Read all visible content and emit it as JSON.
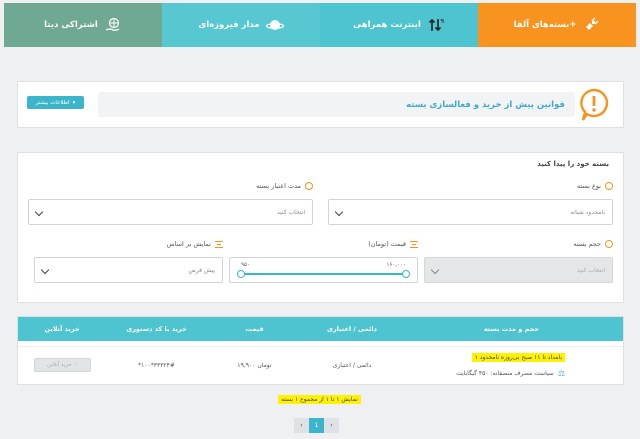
{
  "tabs": [
    {
      "label": "بسته‌های آلفا+",
      "icon": "satellite-icon",
      "color": "#f7931e"
    },
    {
      "label": "اینترنت همراهی",
      "icon": "data-arrows-icon",
      "color": "#4dc4d0"
    },
    {
      "label": "مدار فیروزه‌ای",
      "icon": "planet-icon",
      "color": "#57c7d2"
    },
    {
      "label": "اشتراکی دیتا",
      "icon": "globe-hand-icon",
      "color": "#6fa993"
    }
  ],
  "rules": {
    "title": "قوانین پیش از خرید و فعالسازی بسته",
    "more_label": "اطلاعات بیشتر"
  },
  "finder": {
    "heading": "بسته خود را پیدا کنید",
    "type_label": "نوع بسته",
    "type_value": "نامحدود شبانه",
    "duration_label": "مدت اعتبار بسته",
    "duration_placeholder": "انتخاب کنید",
    "volume_label": "حجم بسته",
    "volume_placeholder": "انتخاب کنید",
    "price_label": "قیمت (تومان)",
    "price_max": "۱۶۰,۰۰۰",
    "price_min": "۹۵۰",
    "sort_label": "نمایش بر اساس",
    "sort_value": "پیش فرض"
  },
  "table": {
    "headers": [
      "حجم و مدت بسته",
      "دائمی / اعتباری",
      "قیمت",
      "خرید با کد دستوری",
      "خرید آنلاین"
    ],
    "rows": [
      {
        "name": "۱ بامداد تا ۱۱ صبح بی‌روزه نامحدود",
        "fair_use": "سیاست مصرف منصفانه: ۴۵۰ گیگابایت",
        "type": "دائمی / اعتباری",
        "price": "۱۹,۹۰۰ تومان",
        "ussd": "*۱۰۰*۳۳۳۲۴#",
        "buy_label": "خرید آنلاین"
      }
    ]
  },
  "paging": {
    "info": "نمایش ۱ تا ۱ از مجموع ۱ بسته",
    "current": "1",
    "prev": "‹",
    "next": "›"
  }
}
